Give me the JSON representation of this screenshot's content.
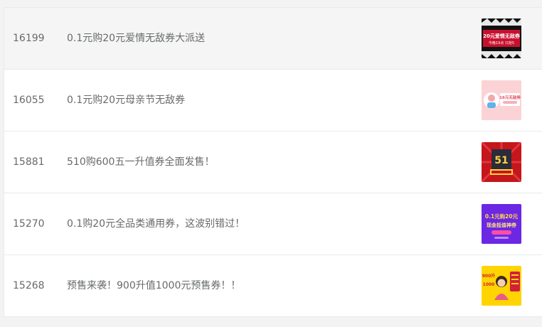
{
  "rows": [
    {
      "id": "16199",
      "title": "0.1元购20元爱情无敌券大派送",
      "thumb_icon": "valentine-coupon-banner-icon",
      "thumb_text": [
        "20元爱情无敌券",
        "今晚19点 只抢5"
      ]
    },
    {
      "id": "16055",
      "title": "0.1元购20元母亲节无敌券",
      "thumb_icon": "mothers-day-coupon-banner-icon",
      "thumb_text": [
        "16元无敌券"
      ]
    },
    {
      "id": "15881",
      "title": "510购600五一升值券全面发售！",
      "thumb_icon": "may-day-coupon-banner-icon",
      "thumb_text": [
        "51"
      ]
    },
    {
      "id": "15270",
      "title": "0.1购20元全品类通用券，这波别错过！",
      "thumb_icon": "universal-coupon-banner-icon",
      "thumb_text": [
        "0.1元购20元",
        "现金抵值神券"
      ]
    },
    {
      "id": "15268",
      "title": "预售来袭！900升值1000元预售券！！",
      "thumb_icon": "presale-coupon-banner-icon",
      "thumb_text": [
        "900升",
        "1000"
      ]
    }
  ],
  "colors": {
    "text": "#676a6c",
    "border": "#e7eaec",
    "highlight_row": "#f5f5f5"
  }
}
